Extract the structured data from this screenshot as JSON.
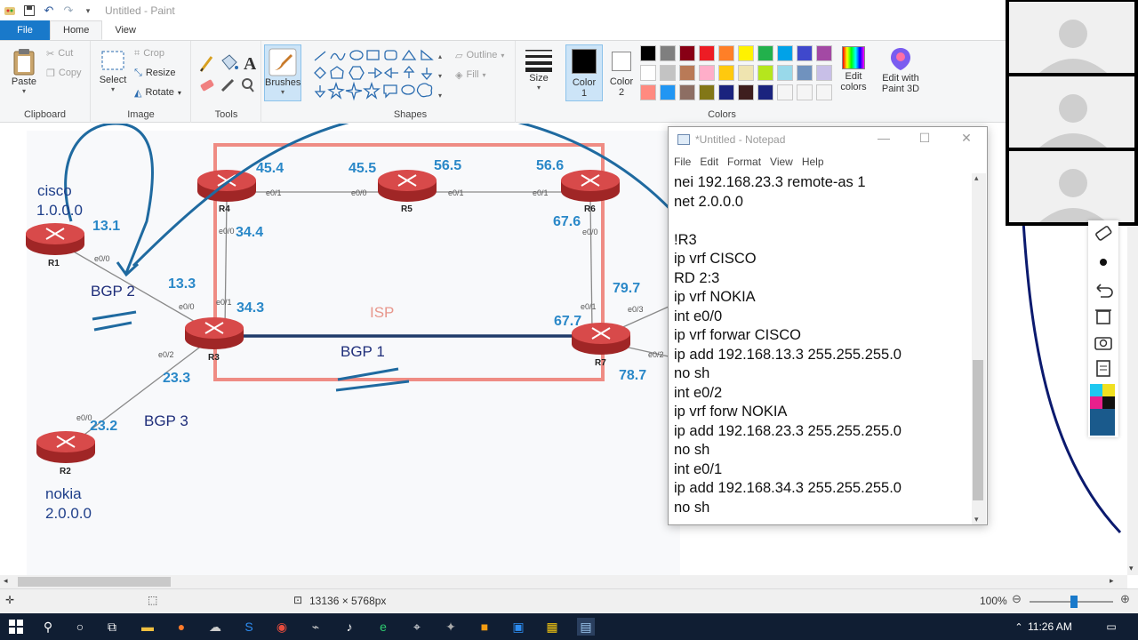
{
  "window": {
    "title": "Untitled - Paint"
  },
  "tabs": {
    "file": "File",
    "home": "Home",
    "view": "View"
  },
  "ribbon": {
    "clipboard": {
      "paste": "Paste",
      "cut": "Cut",
      "copy": "Copy",
      "group": "Clipboard"
    },
    "image": {
      "select": "Select",
      "crop": "Crop",
      "resize": "Resize",
      "rotate": "Rotate",
      "group": "Image"
    },
    "tools": {
      "group": "Tools"
    },
    "brushes": {
      "label": "Brushes"
    },
    "shapes": {
      "outline": "Outline",
      "fill": "Fill",
      "group": "Shapes"
    },
    "size": {
      "label": "Size"
    },
    "colors": {
      "color1": "Color",
      "color1_num": "1",
      "color2": "Color",
      "color2_num": "2",
      "edit_colors": "Edit",
      "edit_colors2": "colors",
      "edit_paint3d": "Edit with",
      "edit_paint3d2": "Paint 3D",
      "group": "Colors",
      "palette": [
        "#000000",
        "#7f7f7f",
        "#880015",
        "#ed1c24",
        "#ff7f27",
        "#fff200",
        "#22b14c",
        "#00a2e8",
        "#3f48cc",
        "#a349a4",
        "#ffffff",
        "#c3c3c3",
        "#b97a57",
        "#ffaec9",
        "#ffc90e",
        "#efe4b0",
        "#b5e61d",
        "#99d9ea",
        "#7092be",
        "#c8bfe7",
        "#ff8a80",
        "#2196f3",
        "#8d6e63",
        "#827717",
        "#1a237e",
        "#3e1e1e",
        "#1a237e",
        "#f5f5f5",
        "#f5f5f5",
        "#f5f5f5"
      ]
    }
  },
  "diagram": {
    "routers": {
      "r1": "R1",
      "r2": "R2",
      "r3": "R3",
      "r4": "R4",
      "r5": "R5",
      "r6": "R6",
      "r7": "R7"
    },
    "ips": {
      "r4_a": "45.4",
      "r5_a": "45.5",
      "r5_b": "56.5",
      "r6_a": "56.6",
      "r1": "13.1",
      "r4_b": "34.4",
      "r6_b": "67.6",
      "r3_a": "13.3",
      "r3_b": "34.3",
      "r7_a": "67.7",
      "r7_b": "79.7",
      "r3_c": "23.3",
      "r7_c": "78.7",
      "r2": "23.2"
    },
    "interfaces": {
      "r4_e01": "e0/1",
      "r5_e00": "e0/0",
      "r5_e01": "e0/1",
      "r6_e01": "e0/1",
      "r4_e00": "e0/0",
      "r6_e00": "e0/0",
      "r1_e00": "e0/0",
      "r3_e00": "e0/0",
      "r3_e01": "e0/1",
      "r7_e01": "e0/1",
      "r7_e03": "e0/3",
      "r3_e02": "e0/2",
      "r7_e02": "e0/2",
      "r2_e00": "e0/0"
    },
    "labels": {
      "bgp1": "BGP 1",
      "bgp2": "BGP 2",
      "bgp3": "BGP 3",
      "isp": "ISP",
      "cisco": "cisco",
      "cisco_net": "1.0.0.0",
      "nokia": "nokia",
      "nokia_net": "2.0.0.0"
    }
  },
  "notepad": {
    "title": "*Untitled - Notepad",
    "menu": [
      "File",
      "Edit",
      "Format",
      "View",
      "Help"
    ],
    "lines": [
      "nei 192.168.23.3 remote-as 1",
      "net 2.0.0.0",
      "",
      "!R3",
      "ip vrf CISCO",
      "RD 2:3",
      "ip vrf NOKIA",
      "int e0/0",
      "ip vrf forwar CISCO",
      "ip add 192.168.13.3 255.255.255.0",
      "no sh",
      "int e0/2",
      "ip vrf forw NOKIA",
      "ip add 192.168.23.3 255.255.255.0",
      "no sh",
      "int e0/1",
      "ip add 192.168.34.3 255.255.255.0",
      "no sh"
    ]
  },
  "status": {
    "dimensions": "13136 × 5768px",
    "zoom": "100%"
  },
  "taskbar": {
    "time": "11:26 AM"
  }
}
